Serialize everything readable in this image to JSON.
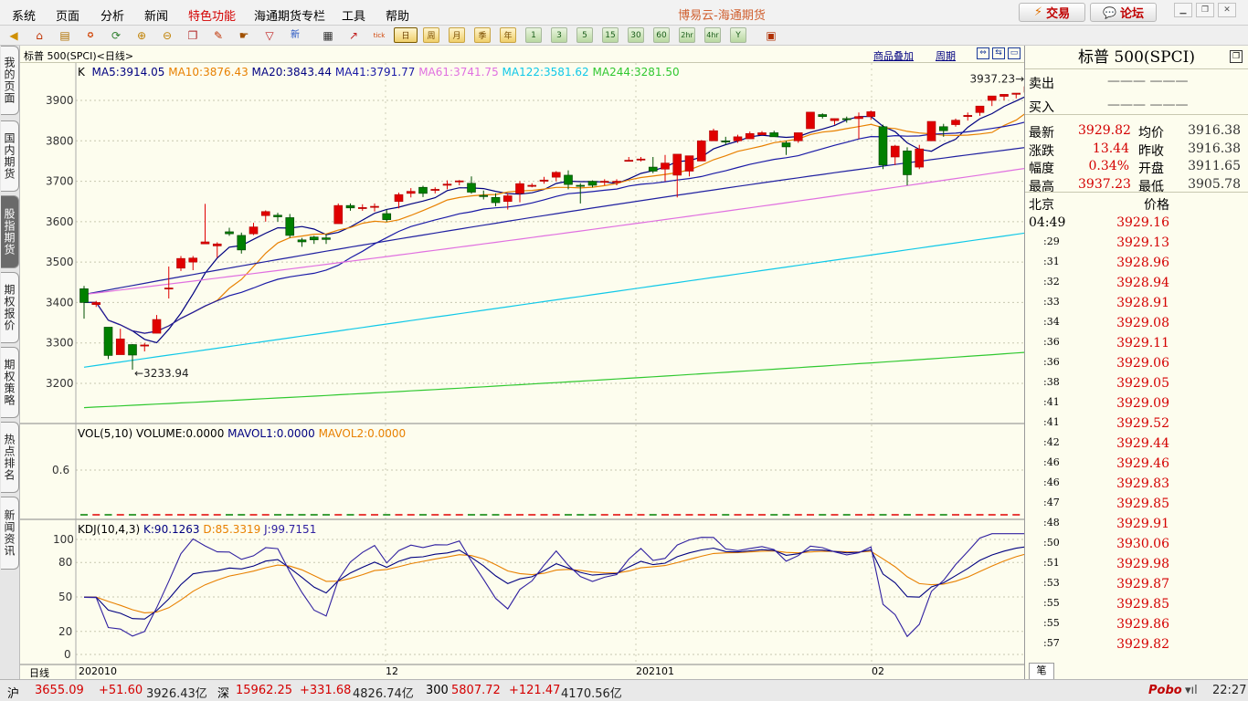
{
  "menu": [
    "系统",
    "页面",
    "分析",
    "新闻",
    "特色功能",
    "海通期货专栏",
    "工具",
    "帮助"
  ],
  "app_title": "博易云-海通期货",
  "top_buttons": {
    "trade": "交易",
    "forum": "论坛"
  },
  "toolbar": {
    "periods": [
      "日",
      "周",
      "月",
      "季",
      "年",
      "1",
      "3",
      "5",
      "15",
      "30",
      "60",
      "2hr",
      "4hr",
      "Y"
    ],
    "active_period": "日"
  },
  "left_tabs": [
    "我的页面",
    "国内期货",
    "股指期货",
    "期权报价",
    "期权策略",
    "热点排名",
    "新闻资讯"
  ],
  "chart_header": {
    "symbol": "标普 500(SPCI)<日线>",
    "overlay_link": "商品叠加",
    "period_link": "周期"
  },
  "kline": {
    "label": "K",
    "ma": [
      {
        "text": "MA5:3914.05",
        "color": "#000080"
      },
      {
        "text": "MA10:3876.43",
        "color": "#e88000"
      },
      {
        "text": "MA20:3843.44",
        "color": "#000080"
      },
      {
        "text": "MA41:3791.77",
        "color": "#1a1aa6"
      },
      {
        "text": "MA61:3741.75",
        "color": "#e070e0"
      },
      {
        "text": "MA122:3581.62",
        "color": "#10c8e8"
      },
      {
        "text": "MA244:3281.50",
        "color": "#30c830"
      }
    ],
    "yticks": [
      3900,
      3800,
      3700,
      3600,
      3500,
      3400,
      3300,
      3200
    ],
    "high_label": "3937.23",
    "low_label": "3233.94"
  },
  "volume": {
    "label": "VOL(5,10)",
    "volume": "VOLUME:0.0000",
    "mavol1": "MAVOL1:0.0000",
    "mavol2": "MAVOL2:0.0000",
    "ytick": "0.6"
  },
  "kdj": {
    "label": "KDJ(10,4,3)",
    "k": "K:90.1263",
    "d": "D:85.3319",
    "j": "J:99.7151",
    "yticks": [
      100,
      80,
      50,
      20,
      0
    ]
  },
  "x_labels": {
    "axis": "日线",
    "labels": [
      "202010",
      "12",
      "202101",
      "02"
    ]
  },
  "chart_data": {
    "type": "candlestick",
    "ohlc": [
      [
        3434,
        3441,
        3360,
        3400
      ],
      [
        3395,
        3404,
        3389,
        3400
      ],
      [
        3339,
        3339,
        3260,
        3269
      ],
      [
        3271,
        3335,
        3271,
        3310
      ],
      [
        3296,
        3297,
        3233.94,
        3270
      ],
      [
        3294,
        3300,
        3279,
        3295
      ],
      [
        3324,
        3369,
        3324,
        3358
      ],
      [
        3435,
        3489,
        3410,
        3436
      ],
      [
        3485,
        3515,
        3478,
        3509
      ],
      [
        3500,
        3515,
        3480,
        3510
      ],
      [
        3545,
        3644,
        3545,
        3550
      ],
      [
        3540,
        3549,
        3511,
        3545
      ],
      [
        3575,
        3585,
        3565,
        3570
      ],
      [
        3566,
        3573,
        3521,
        3530
      ],
      [
        3570,
        3597,
        3567,
        3587
      ],
      [
        3615,
        3628,
        3600,
        3625
      ],
      [
        3616,
        3622,
        3600,
        3612
      ],
      [
        3610,
        3619,
        3560,
        3566
      ],
      [
        3555,
        3560,
        3538,
        3550
      ],
      [
        3562,
        3565,
        3545,
        3555
      ],
      [
        3560,
        3569,
        3545,
        3556
      ],
      [
        3595,
        3645,
        3595,
        3640
      ],
      [
        3640,
        3645,
        3627,
        3634
      ],
      [
        3635,
        3643,
        3627,
        3635
      ],
      [
        3638,
        3645,
        3625,
        3638
      ],
      [
        3620,
        3630,
        3600,
        3605
      ],
      [
        3650,
        3672,
        3633,
        3667
      ],
      [
        3670,
        3683,
        3660,
        3675
      ],
      [
        3685,
        3689,
        3661,
        3670
      ],
      [
        3680,
        3685,
        3670,
        3680
      ],
      [
        3690,
        3702,
        3680,
        3693
      ],
      [
        3700,
        3703,
        3690,
        3701
      ],
      [
        3695,
        3712,
        3669,
        3673
      ],
      [
        3665,
        3677,
        3655,
        3662
      ],
      [
        3660,
        3670,
        3638,
        3647
      ],
      [
        3650,
        3670,
        3630,
        3664
      ],
      [
        3670,
        3700,
        3648,
        3694
      ],
      [
        3690,
        3695,
        3685,
        3690
      ],
      [
        3700,
        3711,
        3694,
        3703
      ],
      [
        3710,
        3725,
        3700,
        3722
      ],
      [
        3715,
        3727,
        3680,
        3692
      ],
      [
        3690,
        3695,
        3645,
        3688
      ],
      [
        3700,
        3702,
        3685,
        3690
      ],
      [
        3700,
        3705,
        3690,
        3700
      ],
      [
        3700,
        3705,
        3690,
        3700
      ],
      [
        3750,
        3760,
        3750,
        3752
      ],
      [
        3755,
        3760,
        3749,
        3755
      ],
      [
        3735,
        3760,
        3720,
        3725
      ],
      [
        3730,
        3765,
        3700,
        3745
      ],
      [
        3715,
        3750,
        3660,
        3767
      ],
      [
        3725,
        3760,
        3712,
        3763
      ],
      [
        3750,
        3802,
        3750,
        3800
      ],
      [
        3800,
        3830,
        3800,
        3825
      ],
      [
        3800,
        3810,
        3790,
        3797
      ],
      [
        3800,
        3815,
        3795,
        3810
      ],
      [
        3805,
        3823,
        3805,
        3818
      ],
      [
        3815,
        3824,
        3815,
        3820
      ],
      [
        3820,
        3825,
        3810,
        3810
      ],
      [
        3795,
        3800,
        3765,
        3785
      ],
      [
        3800,
        3820,
        3795,
        3820
      ],
      [
        3830,
        3870,
        3830,
        3871
      ],
      [
        3865,
        3868,
        3855,
        3860
      ],
      [
        3850,
        3855,
        3840,
        3855
      ],
      [
        3855,
        3860,
        3845,
        3854
      ],
      [
        3855,
        3870,
        3805,
        3860
      ],
      [
        3860,
        3875,
        3852,
        3872
      ],
      [
        3835,
        3840,
        3730,
        3740
      ],
      [
        3760,
        3790,
        3740,
        3787
      ],
      [
        3775,
        3784,
        3690,
        3716
      ],
      [
        3735,
        3790,
        3730,
        3780
      ],
      [
        3800,
        3847,
        3800,
        3848
      ],
      [
        3835,
        3842,
        3810,
        3825
      ],
      [
        3840,
        3855,
        3835,
        3851
      ],
      [
        3860,
        3870,
        3850,
        3863
      ],
      [
        3870,
        3880,
        3862,
        3886
      ],
      [
        3900,
        3910,
        3886,
        3911
      ],
      [
        3910,
        3915,
        3900,
        3915
      ],
      [
        3915,
        3918,
        3905,
        3918
      ],
      [
        3920,
        3937.23,
        3912,
        3934
      ],
      [
        3915,
        3918,
        3905,
        3918
      ],
      [
        3925,
        3932,
        3906,
        3929.82
      ]
    ]
  },
  "quote": {
    "title": "标普  500(SPCI)",
    "sell_label": "卖出",
    "sell_vals": "——— ———",
    "buy_label": "买入",
    "buy_vals": "——— ———",
    "rows": [
      {
        "l1": "最新",
        "v1": "3929.82",
        "l2": "均价",
        "v2": "3916.38"
      },
      {
        "l1": "涨跌",
        "v1": "13.44",
        "l2": "昨收",
        "v2": "3916.38"
      },
      {
        "l1": "幅度",
        "v1": "0.34%",
        "l2": "开盘",
        "v2": "3911.65"
      },
      {
        "l1": "最高",
        "v1": "3937.23",
        "l2": "最低",
        "v2": "3905.78"
      }
    ],
    "tick_head_left": "北京",
    "tick_head_right": "价格",
    "ticks": [
      {
        "t": "04:49",
        "p": "3929.16"
      },
      {
        "t": ":29",
        "p": "3929.13"
      },
      {
        "t": ":31",
        "p": "3928.96"
      },
      {
        "t": ":32",
        "p": "3928.94"
      },
      {
        "t": ":33",
        "p": "3928.91"
      },
      {
        "t": ":34",
        "p": "3929.08"
      },
      {
        "t": ":36",
        "p": "3929.11"
      },
      {
        "t": ":36",
        "p": "3929.06"
      },
      {
        "t": ":38",
        "p": "3929.05"
      },
      {
        "t": ":41",
        "p": "3929.09"
      },
      {
        "t": ":41",
        "p": "3929.52"
      },
      {
        "t": ":42",
        "p": "3929.44"
      },
      {
        "t": ":46",
        "p": "3929.46"
      },
      {
        "t": ":46",
        "p": "3929.83"
      },
      {
        "t": ":47",
        "p": "3929.85"
      },
      {
        "t": ":48",
        "p": "3929.91"
      },
      {
        "t": ":50",
        "p": "3930.06"
      },
      {
        "t": ":51",
        "p": "3929.98"
      },
      {
        "t": ":53",
        "p": "3929.87"
      },
      {
        "t": ":55",
        "p": "3929.85"
      },
      {
        "t": ":55",
        "p": "3929.86"
      },
      {
        "t": ":57",
        "p": "3929.82"
      }
    ],
    "footer_tab": "笔"
  },
  "status": {
    "sh_label": "沪",
    "sh_val": "3655.09",
    "sh_chg": "+51.60",
    "sh_amt": "3926.43亿",
    "sz_label": "深",
    "sz_val": "15962.25",
    "sz_chg": "+331.68",
    "sz_amt": "4826.74亿",
    "c300_label": "300",
    "c300_val": "5807.72",
    "c300_chg": "+121.47",
    "c300_amt": "4170.56亿",
    "brand": "Pobo",
    "time": "22:27"
  }
}
